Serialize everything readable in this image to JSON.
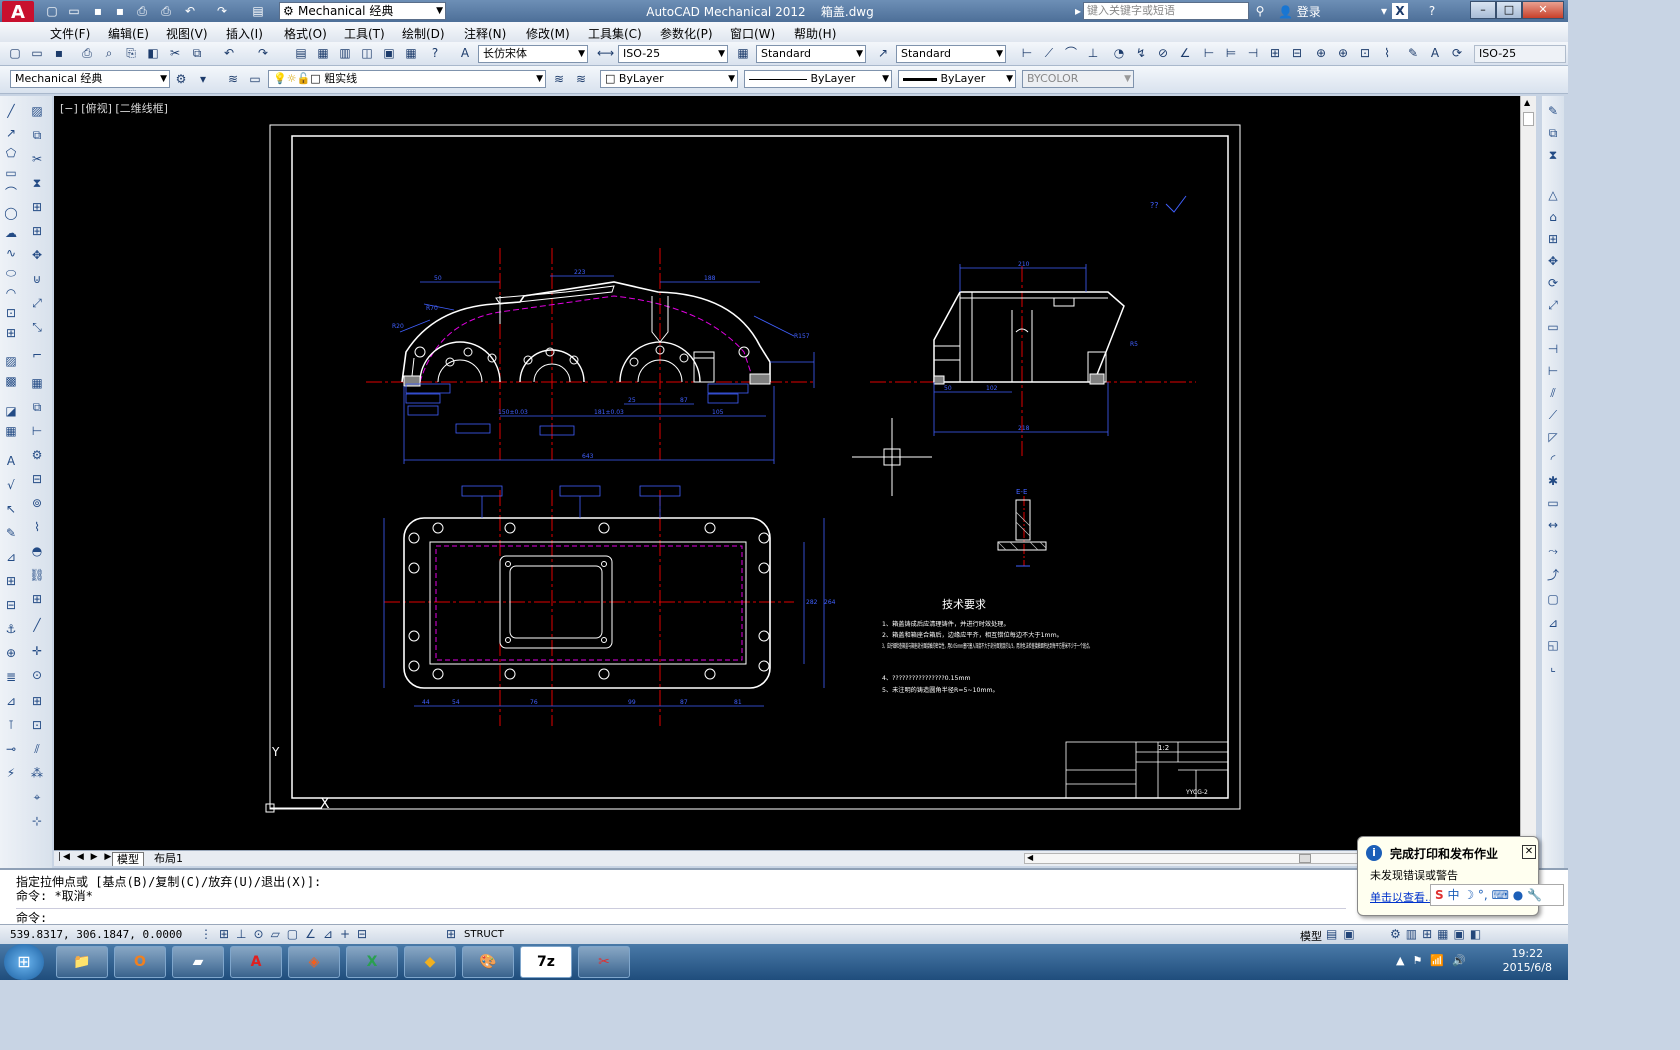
{
  "app": {
    "title": "AutoCAD Mechanical 2012",
    "filename": "箱盖.dwg",
    "workspace": "Mechanical 经典",
    "search_placeholder": "键入关键字或短语",
    "login": "登录",
    "logo": "A"
  },
  "menus": [
    "文件(F)",
    "编辑(E)",
    "视图(V)",
    "插入(I)",
    "格式(O)",
    "工具(T)",
    "绘制(D)",
    "注释(N)",
    "修改(M)",
    "工具集(C)",
    "参数化(P)",
    "窗口(W)",
    "帮助(H)"
  ],
  "toolbar2": {
    "font_style": "长仿宋体",
    "dim_style": "ISO-25",
    "table_style": "Standard",
    "mleader_style": "Standard",
    "dim_style_right": "ISO-25"
  },
  "toolbar3": {
    "workspace": "Mechanical 经典",
    "layer": "粗实线",
    "color": "ByLayer",
    "linetype": "ByLayer",
    "lineweight": "ByLayer",
    "plotstyle": "BYCOLOR"
  },
  "viewport_label": "[−] [俯视] [二维线框]",
  "layout_tabs": [
    "模型",
    "布局1"
  ],
  "command": {
    "line1": "指定拉伸点或 [基点(B)/复制(C)/放弃(U)/退出(X)]:",
    "line2": "命令: *取消*",
    "prompt": "命令:"
  },
  "status": {
    "coords": "539.8317, 306.1847, 0.0000",
    "struct": "STRUCT",
    "model": "模型"
  },
  "notify": {
    "title": "完成打印和发布作业",
    "subtitle": "未发现错误或警告",
    "link": "单击以查看..."
  },
  "ime": {
    "label": "中"
  },
  "clock": {
    "time": "19:22",
    "date": "2015/6/8"
  },
  "drawing": {
    "tech_title": "技术要求",
    "tech_items": [
      "1、箱盖铸成后应清理铸件，并进行时效处理。",
      "2、箱盖和箱座合箱后，边缘应平齐，相互错位每边不大于1mm。",
      "3、应仔细检查箱盖与箱座剖分面接触的密合性，用0.05mm塞尺塞入深度不大于剖分面宽度的1/3。用涂色法检查接触面积达到每平方厘米不少于一个斑点。",
      "4、????????????????0.15mm",
      "5、未注明的铸造圆角半径R=5~10mm。"
    ],
    "section_label": "E-E",
    "title_block": {
      "code": "YYCG-2",
      "scale": "1:2"
    },
    "colors": {
      "bg": "#000000",
      "outline": "#ffffff",
      "dim": "#4060ff",
      "center": "#e00000",
      "hidden": "#e000e0",
      "hatch": "#c0c0c0"
    }
  },
  "taskbar_items": [
    "start",
    "explorer",
    "outlook",
    "app3",
    "autocad",
    "app5",
    "excel",
    "app7",
    "paint",
    "7z",
    "app10"
  ]
}
